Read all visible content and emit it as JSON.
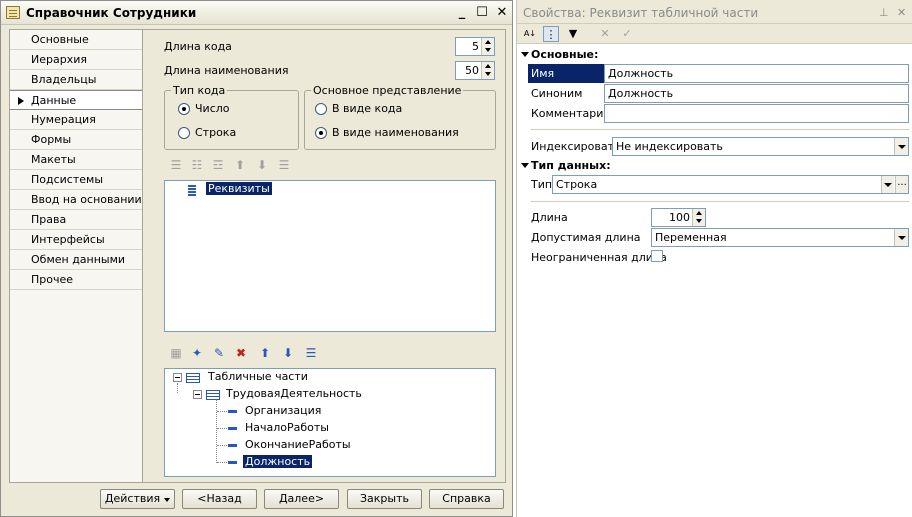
{
  "window": {
    "title": "Справочник Сотрудники",
    "controls": {
      "minimize": "_",
      "maximize": "☐",
      "close": "✕"
    }
  },
  "nav": {
    "items": [
      {
        "label": "Основные"
      },
      {
        "label": "Иерархия"
      },
      {
        "label": "Владельцы"
      },
      {
        "label": "Данные",
        "active": true
      },
      {
        "label": "Нумерация"
      },
      {
        "label": "Формы"
      },
      {
        "label": "Макеты"
      },
      {
        "label": "Подсистемы"
      },
      {
        "label": "Ввод на основании"
      },
      {
        "label": "Права"
      },
      {
        "label": "Интерфейсы"
      },
      {
        "label": "Обмен данными"
      },
      {
        "label": "Прочее"
      }
    ]
  },
  "data_tab": {
    "code_length_label": "Длина кода",
    "code_length_value": "5",
    "name_length_label": "Длина наименования",
    "name_length_value": "50",
    "code_type": {
      "legend": "Тип кода",
      "options": [
        {
          "label": "Число",
          "selected": true
        },
        {
          "label": "Строка",
          "selected": false
        }
      ]
    },
    "main_presentation": {
      "legend": "Основное представление",
      "options": [
        {
          "label": "В виде кода",
          "selected": false
        },
        {
          "label": "В виде наименования",
          "selected": true
        }
      ]
    },
    "attributes_tree": {
      "root": "Реквизиты"
    },
    "tabular_tree": {
      "root": "Табличные части",
      "child": "ТрудоваяДеятельность",
      "attributes": [
        "Организация",
        "НачалоРаботы",
        "ОкончаниеРаботы",
        "Должность"
      ],
      "selected": "Должность"
    }
  },
  "buttons": {
    "actions": "Действия",
    "back": "<Назад",
    "next": "Далее>",
    "close": "Закрыть",
    "help": "Справка"
  },
  "props": {
    "title": "Свойства: Реквизит табличной части",
    "pin": "ᵖ",
    "close": "✕",
    "toolbar": {
      "sort": "A↓Z",
      "cancel": "✕",
      "apply": "✓"
    },
    "sections": {
      "basic": "Основные:",
      "datatype": "Тип данных:"
    },
    "fields": {
      "name_label": "Имя",
      "name_value": "Должность",
      "synonym_label": "Синоним",
      "synonym_value": "Должность",
      "comment_label": "Комментарий",
      "comment_value": "",
      "index_label": "Индексировать",
      "index_value": "Не индексировать",
      "type_label": "Тип",
      "type_value": "Строка",
      "length_label": "Длина",
      "length_value": "100",
      "allowed_length_label": "Допустимая длина",
      "allowed_length_value": "Переменная",
      "unlimited_label": "Неограниченная длина"
    }
  }
}
